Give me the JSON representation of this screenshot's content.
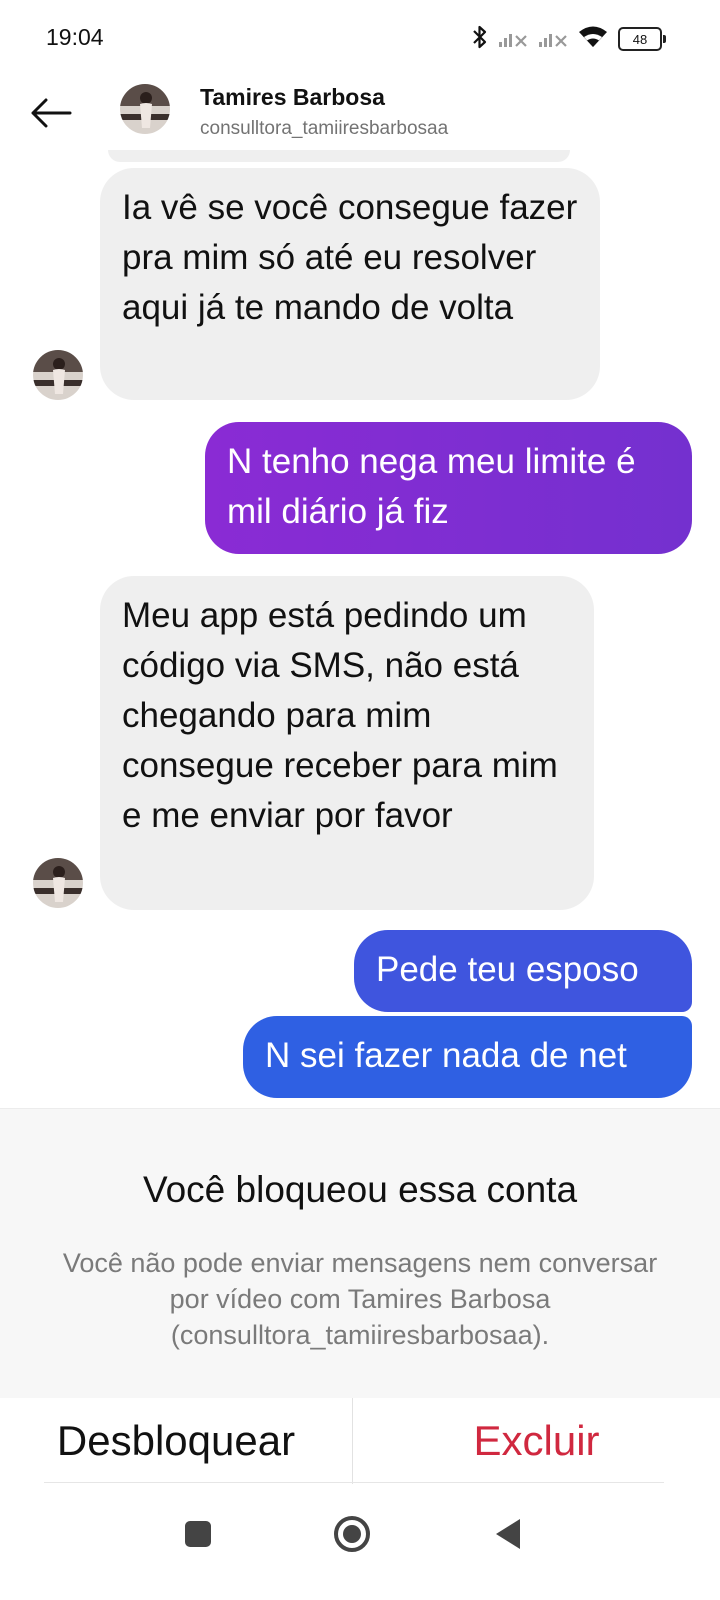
{
  "status_bar": {
    "time": "19:04",
    "battery": "48",
    "icons": [
      "bluetooth-icon",
      "signal-off-icon",
      "signal-off-icon",
      "wifi-icon",
      "battery-icon"
    ]
  },
  "header": {
    "name": "Tamires Barbosa",
    "username": "consulltora_tamiiresbarbosaa",
    "back_icon": "arrow-left-icon"
  },
  "messages": [
    {
      "direction": "incoming",
      "text": "Ia vê se você consegue fazer pra mim só até eu resolver aqui já te mando de volta"
    },
    {
      "direction": "outgoing",
      "text": "N tenho nega meu limite é mil diário já fiz"
    },
    {
      "direction": "incoming",
      "text": "Meu app está pedindo um código via SMS, não está chegando para mim consegue receber para mim e me enviar por favor"
    },
    {
      "direction": "outgoing",
      "text": "Pede teu esposo"
    },
    {
      "direction": "outgoing",
      "text": "N sei fazer nada de net"
    }
  ],
  "blocked": {
    "title": "Você bloqueou essa conta",
    "description": "Você não pode enviar mensagens nem conversar por vídeo com Tamires Barbosa (consulltora_tamiiresbarbosaa)."
  },
  "actions": {
    "unblock_label": "Desbloquear",
    "delete_label": "Excluir"
  },
  "colors": {
    "outgoing_purple": "#7b2bd0",
    "outgoing_blue": "#3a5be0",
    "delete_red": "#d0283f",
    "incoming_bg": "#efefef"
  },
  "nav": [
    "recents-square-icon",
    "home-circle-icon",
    "back-triangle-icon"
  ]
}
